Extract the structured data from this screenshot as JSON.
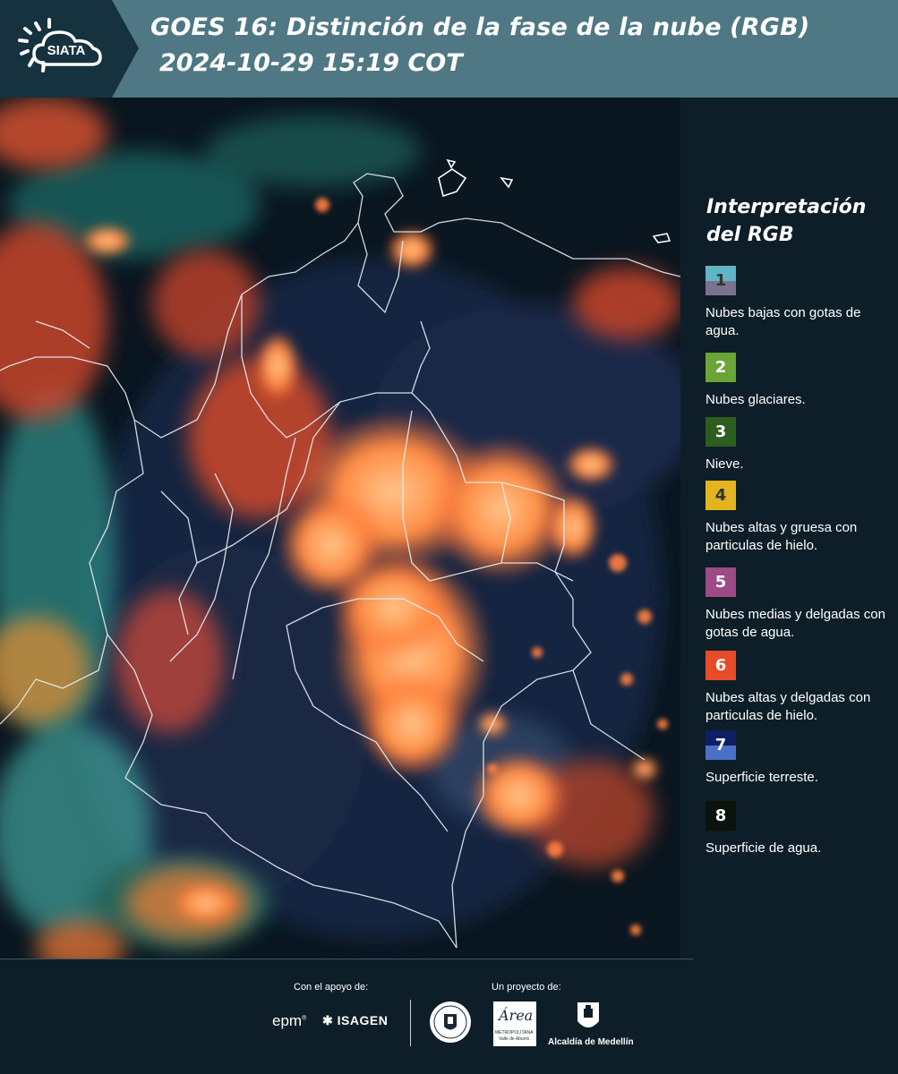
{
  "header": {
    "logo_text": "SIATA",
    "title_line1": "GOES 16: Distinción de la fase de la nube (RGB)",
    "title_line2": "2024-10-29 15:19 COT"
  },
  "legend": {
    "title_line1": "Interpretación",
    "title_line2": "del RGB",
    "items": [
      {
        "number": "1",
        "label": "Nubes bajas con gotas de agua.",
        "color_top": "#5fb6c4",
        "color_bottom": "#7a7390",
        "num_color": "#333333"
      },
      {
        "number": "2",
        "label": "Nubes glaciares.",
        "color_top": "#6aa535",
        "color_bottom": "#6aa535",
        "num_color": "#ffffff"
      },
      {
        "number": "3",
        "label": "Nieve.",
        "color_top": "#2c5e1d",
        "color_bottom": "#2c5e1d",
        "num_color": "#ffffff"
      },
      {
        "number": "4",
        "label": "Nubes altas y gruesa con particulas de hielo.",
        "color_top": "#e2b41f",
        "color_bottom": "#e2b41f",
        "num_color": "#333333"
      },
      {
        "number": "5",
        "label": "Nubes medias y delgadas con gotas de agua.",
        "color_top": "#9d4a86",
        "color_bottom": "#9d4a86",
        "num_color": "#ffffff"
      },
      {
        "number": "6",
        "label": "Nubes altas y delgadas con particulas de hielo.",
        "color_top": "#e64c28",
        "color_bottom": "#e64c28",
        "num_color": "#ffffff"
      },
      {
        "number": "7",
        "label": "Superficie terreste.",
        "color_top": "#0f1f63",
        "color_bottom": "#4a70c8",
        "num_color": "#ffffff"
      },
      {
        "number": "8",
        "label": "Superficie de agua.",
        "color_top": "#0a140c",
        "color_bottom": "#0a140c",
        "num_color": "#ffffff"
      }
    ]
  },
  "footer": {
    "support_caption": "Con el apoyo de:",
    "project_caption": "Un proyecto de:",
    "sponsor_epm": "epm",
    "sponsor_isagen": "ISAGEN",
    "area_logo_text": "Área",
    "area_sub1": "METROPOLITANA",
    "area_sub2": "Valle de Aburrá",
    "alcaldia": "Alcaldía de Medellín"
  },
  "colors": {
    "header_bg": "#4f7884",
    "page_bg": "#0e1e28",
    "cloud_orange": "#ff7a3a",
    "cloud_red": "#d8452a",
    "cloud_teal": "#3f9e9a",
    "land_navy": "#142a4a"
  }
}
